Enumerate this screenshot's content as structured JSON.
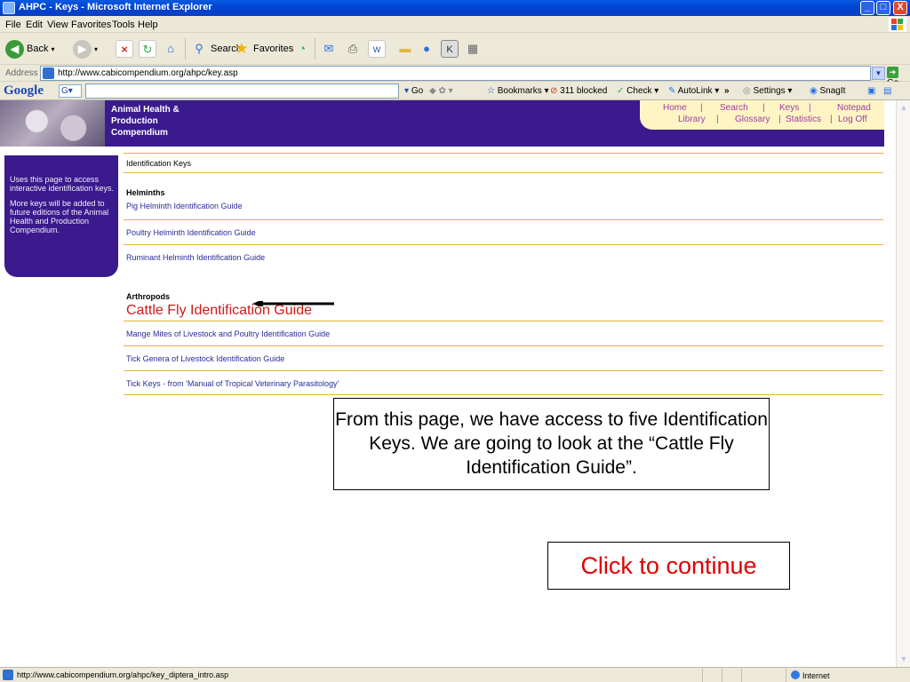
{
  "window": {
    "title": "AHPC - Keys - Microsoft Internet Explorer",
    "controls": {
      "minimize": "_",
      "maximize": "□",
      "close": "X"
    }
  },
  "menubar": {
    "items": [
      "File",
      "Edit",
      "View",
      "Favorites",
      "Tools",
      "Help"
    ]
  },
  "toolbar": {
    "back": "Back",
    "search": "Search",
    "favorites": "Favorites"
  },
  "address": {
    "label": "Address",
    "url": "http://www.cabicompendium.org/ahpc/key.asp",
    "go": "Go"
  },
  "google_toolbar": {
    "logo": "Google",
    "go": "Go",
    "bookmarks": "Bookmarks",
    "blocked": "311 blocked",
    "check": "Check",
    "autolink": "AutoLink",
    "more": "»",
    "settings": "Settings",
    "snagit": "SnagIt"
  },
  "site": {
    "title_lines": [
      "Animal Health &",
      "Production",
      "Compendium"
    ],
    "nav": {
      "home": "Home",
      "search": "Search",
      "keys": "Keys",
      "notepad": "Notepad",
      "library": "Library",
      "glossary": "Glossary",
      "statistics": "Statistics",
      "logoff": "Log Off",
      "separator": "|"
    },
    "sidebar": {
      "para1": "Uses this page to access interactive identification keys.",
      "para2": "More keys will be added to future editions of the Animal Health and Production Compendium."
    },
    "content": {
      "header": "Identification Keys",
      "groups": [
        {
          "title": "Helminths",
          "links": [
            "Pig Helminth Identification Guide",
            "Poultry Helminth Identification Guide",
            "Ruminant Helminth Identification Guide"
          ]
        },
        {
          "title": "Arthropods",
          "links": [
            "Cattle Fly Identification Guide",
            "Mange Mites of Livestock and Poultry Identification Guide",
            "Tick Genera of Livestock Identification Guide",
            "Tick Keys - from 'Manual of Tropical Veterinary Parasitology'"
          ]
        }
      ]
    }
  },
  "overlay": {
    "callout": "From this page, we have access to five Identification Keys.  We are going to look at the “Cattle Fly Identification Guide”.",
    "continue": "Click to continue"
  },
  "statusbar": {
    "url": "http://www.cabicompendium.org/ahpc/key_diptera_intro.asp",
    "zone": "Internet"
  },
  "colors": {
    "site_purple": "#3a1a8c",
    "nav_box": "#fff4c4",
    "link": "#2b2b9c",
    "active_link": "#cc1a1a",
    "divider": "#e6b33c",
    "continue_text": "#e00000"
  }
}
